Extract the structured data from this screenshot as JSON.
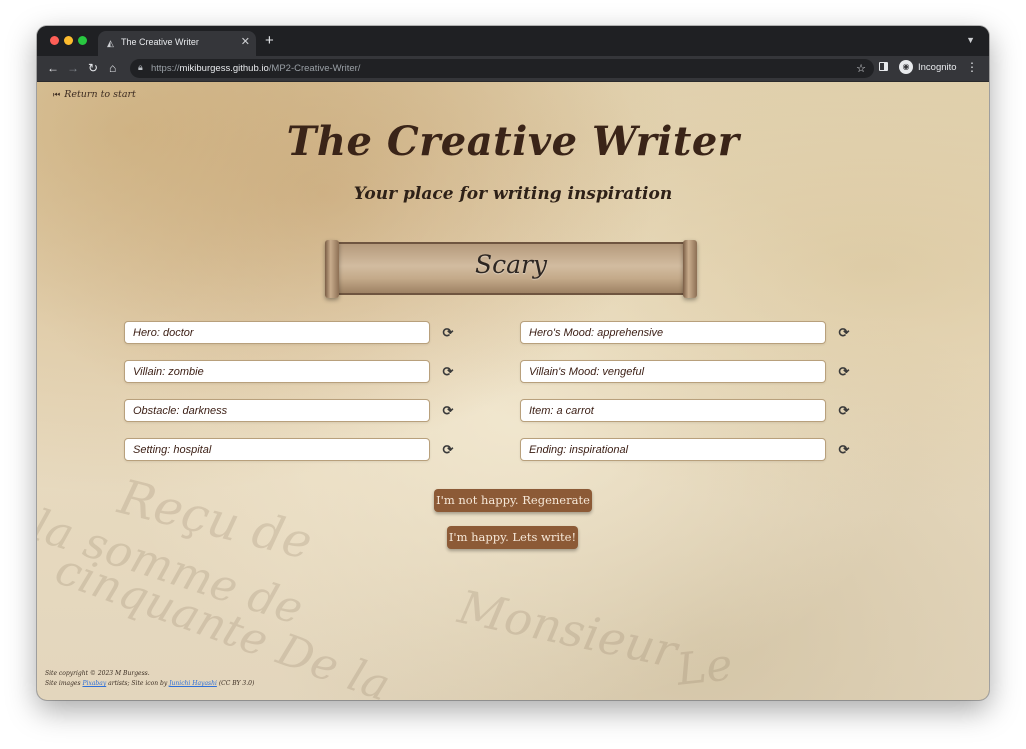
{
  "browser": {
    "tab_title": "The Creative Writer",
    "url_prefix": "https://",
    "url_domain": "mikiburgess.github.io",
    "url_path": "/MP2-Creative-Writer/",
    "profile_label": "Incognito"
  },
  "page": {
    "return_link": "Return to start",
    "title": "The Creative Writer",
    "subtitle": "Your place for writing inspiration",
    "genre": "Scary"
  },
  "prompts_left": [
    {
      "label": "Hero: doctor"
    },
    {
      "label": "Villain: zombie"
    },
    {
      "label": "Obstacle: darkness"
    },
    {
      "label": "Setting: hospital"
    }
  ],
  "prompts_right": [
    {
      "label": "Hero's Mood: apprehensive"
    },
    {
      "label": "Villain's Mood: vengeful"
    },
    {
      "label": "Item: a carrot"
    },
    {
      "label": "Ending: inspirational"
    }
  ],
  "buttons": {
    "regenerate": "I'm not happy. Regenerate",
    "write": "I'm happy. Lets write!"
  },
  "footer": {
    "copyright": "Site copyright © 2023 M Burgess.",
    "images_prefix": "Site images",
    "images_link": "Pixabay",
    "images_mid": "artists; Site icon by",
    "icon_link": "Junichi Hayashi",
    "icon_suffix": "(CC BY 3.0)"
  },
  "colors": {
    "button_bg": "#8c5a36",
    "title": "#3a2418",
    "field_border": "#b8a07c"
  }
}
